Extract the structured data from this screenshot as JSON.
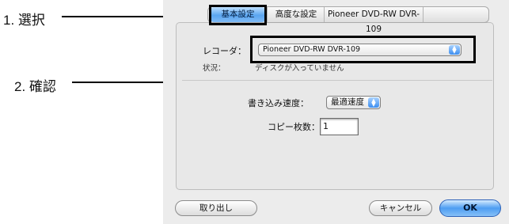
{
  "annotations": {
    "select_label": "1. 選択",
    "confirm_label": "2. 確認"
  },
  "tabs": [
    "基本設定",
    "高度な設定",
    "Pioneer DVD-RW DVR-109"
  ],
  "recorder": {
    "label": "レコーダ：",
    "value": "Pioneer DVD-RW DVR-109",
    "status_label": "状況：",
    "status_value": "ディスクが入っていません"
  },
  "write_speed": {
    "label": "書き込み速度：",
    "value": "最適速度"
  },
  "copies": {
    "label": "コピー枚数：",
    "value": "1"
  },
  "buttons": {
    "eject": "取り出し",
    "cancel": "キャンセル",
    "ok": "OK"
  }
}
